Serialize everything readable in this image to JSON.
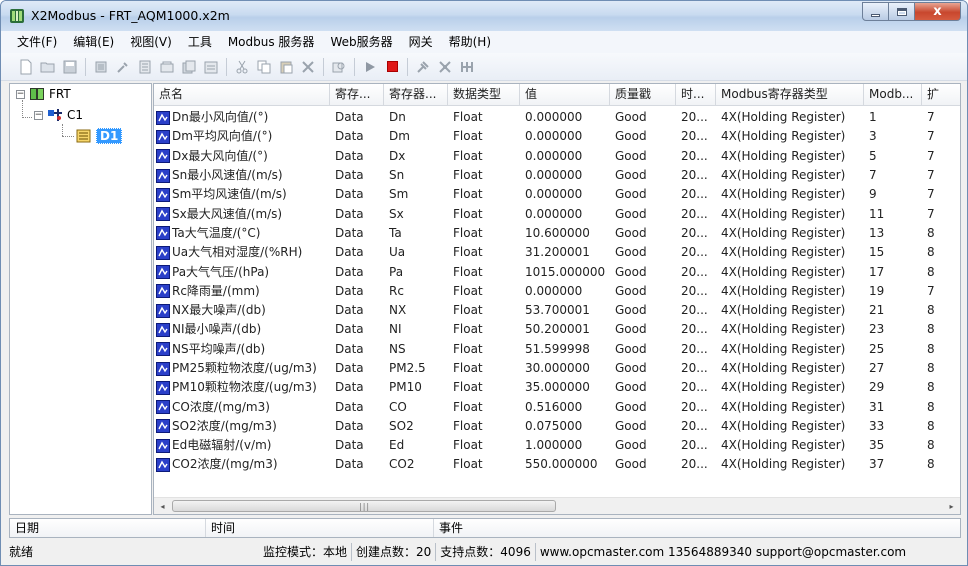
{
  "window": {
    "title": "X2Modbus - FRT_AQM1000.x2m",
    "close_glyph": "x"
  },
  "menu": [
    "文件(F)",
    "编辑(E)",
    "视图(V)",
    "工具",
    "Modbus 服务器",
    "Web服务器",
    "网关",
    "帮助(H)"
  ],
  "toolbar_icons": [
    "new-file-icon",
    "open-folder-icon",
    "save-icon",
    "new-channel-icon",
    "new-device-icon",
    "new-tag-icon",
    "properties-icon",
    "copy-device-icon",
    "paste-device-icon",
    "cut-icon",
    "copy-icon",
    "paste-icon",
    "delete-icon",
    "search-icon",
    "start-icon",
    "stop-icon",
    "tool-icon",
    "network-icon",
    "network-settings-icon"
  ],
  "tree": {
    "root": {
      "label": "FRT",
      "expander": "−"
    },
    "channel": {
      "label": "C1",
      "expander": "−"
    },
    "device": {
      "label": "D1"
    }
  },
  "table": {
    "columns": [
      "点名",
      "寄存...",
      "寄存器...",
      "数据类型",
      "值",
      "质量戳",
      "时...",
      "Modbus寄存器类型",
      "Modb...",
      "扩"
    ],
    "rows": [
      [
        "Dn最小风向值/(°)",
        "Data",
        "Dn",
        "Float",
        "0.000000",
        "Good",
        "20...",
        "4X(Holding Register)",
        "1",
        "7"
      ],
      [
        "Dm平均风向值/(°)",
        "Data",
        "Dm",
        "Float",
        "0.000000",
        "Good",
        "20...",
        "4X(Holding Register)",
        "3",
        "7"
      ],
      [
        "Dx最大风向值/(°)",
        "Data",
        "Dx",
        "Float",
        "0.000000",
        "Good",
        "20...",
        "4X(Holding Register)",
        "5",
        "7"
      ],
      [
        "Sn最小风速值/(m/s)",
        "Data",
        "Sn",
        "Float",
        "0.000000",
        "Good",
        "20...",
        "4X(Holding Register)",
        "7",
        "7"
      ],
      [
        "Sm平均风速值/(m/s)",
        "Data",
        "Sm",
        "Float",
        "0.000000",
        "Good",
        "20...",
        "4X(Holding Register)",
        "9",
        "7"
      ],
      [
        "Sx最大风速值/(m/s)",
        "Data",
        "Sx",
        "Float",
        "0.000000",
        "Good",
        "20...",
        "4X(Holding Register)",
        "11",
        "7"
      ],
      [
        "Ta大气温度/(°C)",
        "Data",
        "Ta",
        "Float",
        "10.600000",
        "Good",
        "20...",
        "4X(Holding Register)",
        "13",
        "8"
      ],
      [
        "Ua大气相对湿度/(%RH)",
        "Data",
        "Ua",
        "Float",
        "31.200001",
        "Good",
        "20...",
        "4X(Holding Register)",
        "15",
        "8"
      ],
      [
        "Pa大气气压/(hPa)",
        "Data",
        "Pa",
        "Float",
        "1015.000000",
        "Good",
        "20...",
        "4X(Holding Register)",
        "17",
        "8"
      ],
      [
        "Rc降雨量/(mm)",
        "Data",
        "Rc",
        "Float",
        "0.000000",
        "Good",
        "20...",
        "4X(Holding Register)",
        "19",
        "7"
      ],
      [
        "NX最大噪声/(db)",
        "Data",
        "NX",
        "Float",
        "53.700001",
        "Good",
        "20...",
        "4X(Holding Register)",
        "21",
        "8"
      ],
      [
        "NI最小噪声/(db)",
        "Data",
        "NI",
        "Float",
        "50.200001",
        "Good",
        "20...",
        "4X(Holding Register)",
        "23",
        "8"
      ],
      [
        "NS平均噪声/(db)",
        "Data",
        "NS",
        "Float",
        "51.599998",
        "Good",
        "20...",
        "4X(Holding Register)",
        "25",
        "8"
      ],
      [
        "PM25颗粒物浓度/(ug/m3)",
        "Data",
        "PM2.5",
        "Float",
        "30.000000",
        "Good",
        "20...",
        "4X(Holding Register)",
        "27",
        "8"
      ],
      [
        "PM10颗粒物浓度/(ug/m3)",
        "Data",
        "PM10",
        "Float",
        "35.000000",
        "Good",
        "20...",
        "4X(Holding Register)",
        "29",
        "8"
      ],
      [
        "CO浓度/(mg/m3)",
        "Data",
        "CO",
        "Float",
        "0.516000",
        "Good",
        "20...",
        "4X(Holding Register)",
        "31",
        "8"
      ],
      [
        "SO2浓度/(mg/m3)",
        "Data",
        "SO2",
        "Float",
        "0.075000",
        "Good",
        "20...",
        "4X(Holding Register)",
        "33",
        "8"
      ],
      [
        "Ed电磁辐射/(v/m)",
        "Data",
        "Ed",
        "Float",
        "1.000000",
        "Good",
        "20...",
        "4X(Holding Register)",
        "35",
        "8"
      ],
      [
        "CO2浓度/(mg/m3)",
        "Data",
        "CO2",
        "Float",
        "550.000000",
        "Good",
        "20...",
        "4X(Holding Register)",
        "37",
        "8"
      ]
    ]
  },
  "scroll": {
    "left": "◂",
    "right": "▸",
    "grip": "|||"
  },
  "log_columns": [
    "日期",
    "时间",
    "事件"
  ],
  "status": {
    "state": "就绪",
    "monitor_mode": "监控模式：本地",
    "created_points": "创建点数：20",
    "supported_points": "支持点数：4096",
    "contact": "www.opcmaster.com 13564889340 support@opcmaster.com"
  },
  "colors": {
    "selection": "#3399ff",
    "stop": "#e01818",
    "tag_icon": "#2a3fc9"
  }
}
